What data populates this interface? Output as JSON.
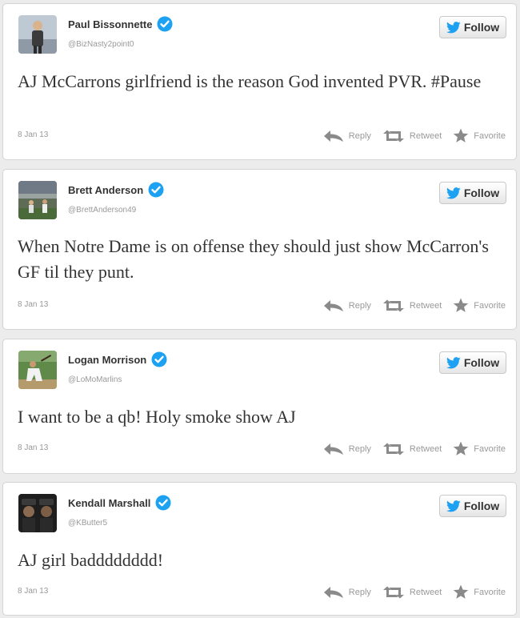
{
  "ui": {
    "follow_label": "Follow",
    "reply_label": "Reply",
    "retweet_label": "Retweet",
    "favorite_label": "Favorite"
  },
  "colors": {
    "verified_blue": "#1da1f2",
    "text": "#333333",
    "muted": "#999999",
    "icon_gray": "#8a8a8a"
  },
  "tweets": [
    {
      "name": "Paul Bissonnette",
      "handle": "@BizNasty2point0",
      "text": "AJ McCarrons girlfriend is the reason God invented PVR. #Pause",
      "date": "8 Jan 13"
    },
    {
      "name": "Brett Anderson",
      "handle": "@BrettAnderson49",
      "text": "When Notre Dame is on offense they should just show McCarron's GF til they punt.",
      "date": "8 Jan 13"
    },
    {
      "name": "Logan Morrison",
      "handle": "@LoMoMarlins",
      "text": "I want to be a qb! Holy smoke show AJ",
      "date": "8 Jan 13"
    },
    {
      "name": "Kendall Marshall",
      "handle": "@KButter5",
      "text": "AJ girl badddddddd!",
      "date": "8 Jan 13"
    }
  ]
}
